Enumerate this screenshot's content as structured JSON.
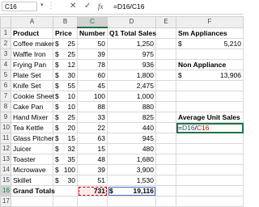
{
  "name_box": "C16",
  "formula_bar": {
    "cancel": "✕",
    "enter": "✓",
    "fx": "fx",
    "formula": "=D16/C16"
  },
  "columns": [
    "A",
    "B",
    "C",
    "D",
    "E",
    "F"
  ],
  "header_row": {
    "product": "Product",
    "price": "Price",
    "number": "Number",
    "sales": "Q1 Total Sales"
  },
  "rows": [
    {
      "n": "2",
      "product": "Coffee maker",
      "price": "25",
      "number": "50",
      "sales": "1,250"
    },
    {
      "n": "3",
      "product": "Waffle Iron",
      "price": "25",
      "number": "39",
      "sales": "975"
    },
    {
      "n": "4",
      "product": "Frying Pan",
      "price": "12",
      "number": "78",
      "sales": "936"
    },
    {
      "n": "5",
      "product": "Plate Set",
      "price": "30",
      "number": "60",
      "sales": "1,800"
    },
    {
      "n": "6",
      "product": "Knife Set",
      "price": "55",
      "number": "45",
      "sales": "2,475"
    },
    {
      "n": "7",
      "product": "Cookie Sheet",
      "price": "10",
      "number": "100",
      "sales": "1,000"
    },
    {
      "n": "8",
      "product": "Cake Pan",
      "price": "10",
      "number": "88",
      "sales": "880"
    },
    {
      "n": "9",
      "product": "Hand Mixer",
      "price": "25",
      "number": "33",
      "sales": "825"
    },
    {
      "n": "10",
      "product": "Tea Kettle",
      "price": "20",
      "number": "22",
      "sales": "440"
    },
    {
      "n": "11",
      "product": "Glass Pitcher",
      "price": "15",
      "number": "63",
      "sales": "945"
    },
    {
      "n": "12",
      "product": "Juicer",
      "price": "32",
      "number": "15",
      "sales": "480"
    },
    {
      "n": "13",
      "product": "Toaster",
      "price": "35",
      "number": "48",
      "sales": "1,680"
    },
    {
      "n": "14",
      "product": "Microwave",
      "price": "100",
      "number": "39",
      "sales": "3,900"
    },
    {
      "n": "15",
      "product": "Skillet",
      "price": "30",
      "number": "51",
      "sales": "1,530"
    }
  ],
  "totals": {
    "n": "16",
    "label": "Grand Totals",
    "number": "731",
    "sales": "19,116"
  },
  "dollar": "$",
  "side": {
    "sm_label": "Sm Appliances",
    "sm_value": "5,210",
    "non_label": "Non Appliance",
    "non_value": "13,906",
    "avg_label": "Average Unit Sales",
    "avg_formula_a": "=",
    "avg_formula_b": "D16",
    "avg_formula_c": "/",
    "avg_formula_d": "C16"
  },
  "colors": {
    "accent": "#217346",
    "ref_red": "#c00000",
    "ref_blue": "#4472c4"
  }
}
